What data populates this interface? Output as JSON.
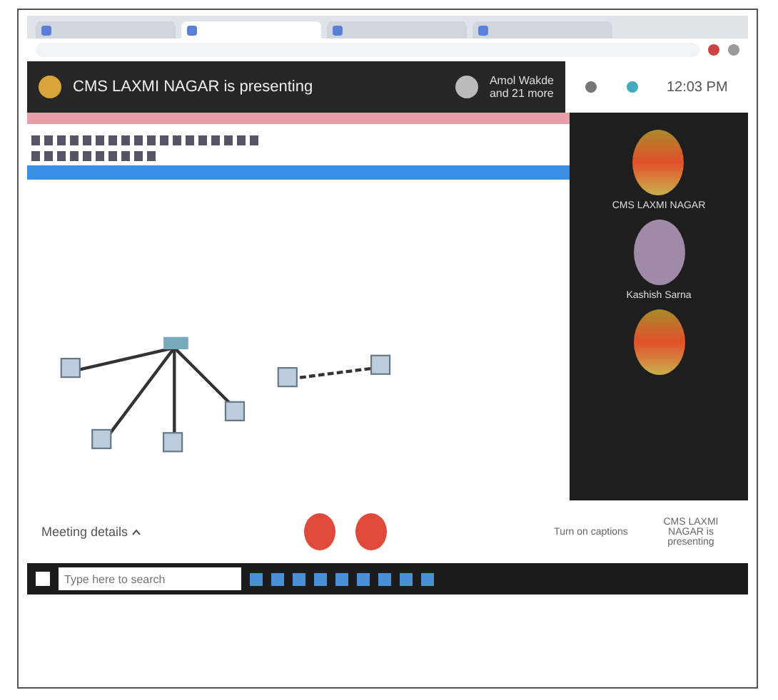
{
  "browser": {
    "tabs": [
      {
        "selected": false
      },
      {
        "selected": true
      },
      {
        "selected": false
      },
      {
        "selected": false
      }
    ]
  },
  "meet_header": {
    "title": "CMS LAXMI NAGAR is presenting",
    "participant": "Amol Wakde",
    "more": "and 21 more",
    "time": "12:03 PM"
  },
  "participants": [
    {
      "kind": "logo",
      "name": "CMS LAXMI NAGAR"
    },
    {
      "kind": "photo",
      "name": "Kashish Sarna"
    },
    {
      "kind": "logo"
    }
  ],
  "controls": {
    "details": "Meeting details",
    "captions": "Turn on captions",
    "presenting": "CMS LAXMI NAGAR is presenting"
  },
  "taskbar": {
    "search": {
      "placeholder": "Type here to search"
    }
  }
}
